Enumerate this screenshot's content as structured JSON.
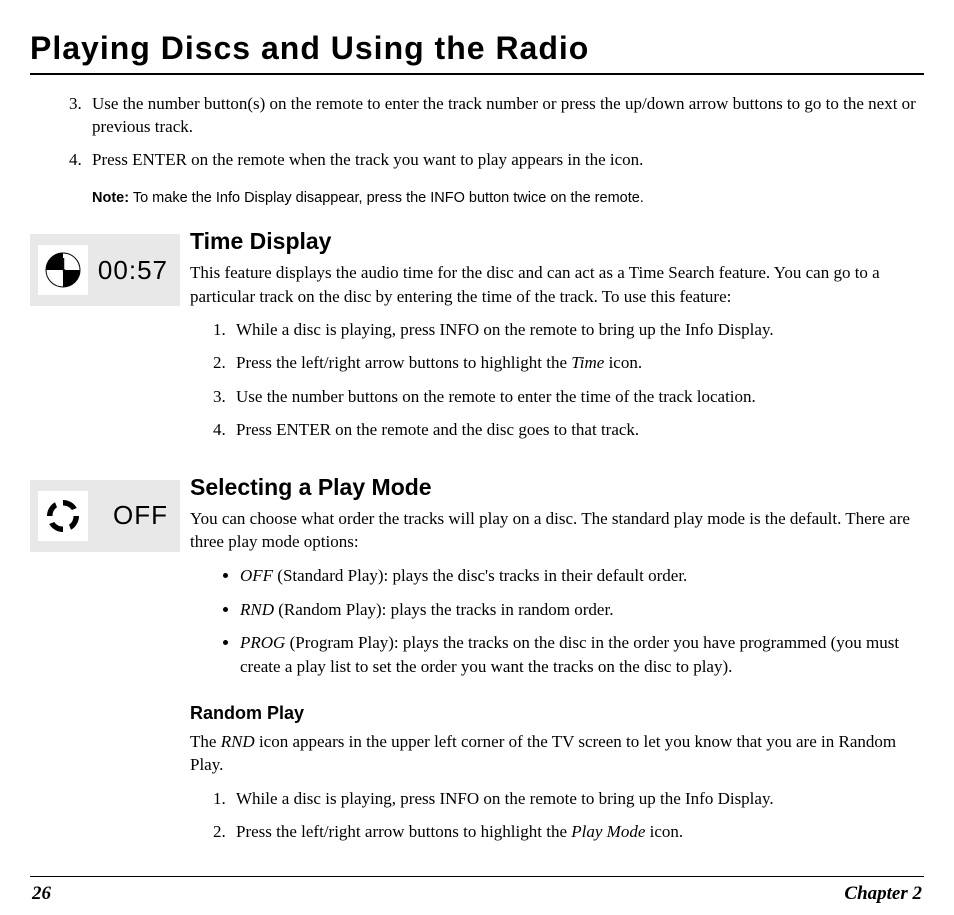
{
  "header": {
    "title": "Playing Discs and Using the Radio"
  },
  "intro_steps": {
    "start": 3,
    "items": [
      "Use the number button(s) on the remote to enter the track number or press the up/down arrow buttons to go to the next or previous track.",
      "Press ENTER on the remote when the track you want to play appears in the icon."
    ]
  },
  "note": {
    "label": "Note:",
    "text": "To make the Info Display disappear, press the INFO button twice on the remote."
  },
  "time_display": {
    "icon_value": "00:57",
    "icon_name": "clock-icon",
    "title": "Time Display",
    "intro": "This feature displays the audio time for the disc and can act as a Time Search feature. You can go to a particular track on the disc by entering the time of the track. To use this feature:",
    "steps": [
      "While a disc is playing, press INFO on the remote to bring up the Info Display.",
      "Press the left/right arrow buttons to highlight the Time icon.",
      "Use the number buttons on the remote to enter the time of the track location.",
      "Press ENTER on the remote and the disc goes to that track."
    ],
    "step2_prefix": "Press the left/right arrow buttons to highlight the ",
    "step2_em": "Time",
    "step2_suffix": " icon."
  },
  "play_mode": {
    "icon_value": "OFF",
    "icon_name": "arrows-icon",
    "title": "Selecting a Play Mode",
    "intro": "You can choose what order the tracks will play on a disc. The standard play mode is the default. There are three play mode options:",
    "bullets": [
      {
        "em": "OFF",
        "text": " (Standard Play): plays the disc's tracks in their default order."
      },
      {
        "em": "RND",
        "text": " (Random Play): plays the tracks in random order."
      },
      {
        "em": "PROG",
        "text": " (Program Play): plays the tracks on the disc in the order you have programmed (you must create a play list to set the order you want the tracks on the disc to play)."
      }
    ]
  },
  "random_play": {
    "title": "Random Play",
    "intro_prefix": "The ",
    "intro_em": "RND",
    "intro_suffix": " icon appears in the upper left corner of the TV screen to let you know that you are in Random Play.",
    "steps": {
      "s1": "While a disc is playing, press INFO on the remote to bring up the Info Display.",
      "s2_prefix": "Press the left/right arrow buttons to highlight the ",
      "s2_em": "Play Mode",
      "s2_suffix": " icon."
    }
  },
  "footer": {
    "page": "26",
    "chapter": "Chapter 2"
  }
}
